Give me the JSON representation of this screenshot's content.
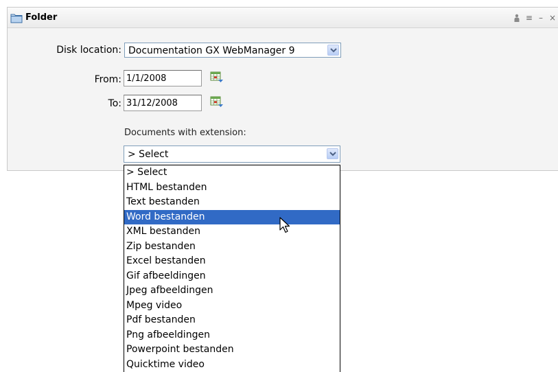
{
  "panel": {
    "title": "Folder",
    "icons": [
      "folder-icon",
      "person-icon",
      "menu-icon",
      "minimize-icon",
      "close-icon"
    ]
  },
  "disk": {
    "label": "Disk location:",
    "value": "Documentation GX WebManager 9"
  },
  "from": {
    "label": "From:",
    "value": "1/1/2008"
  },
  "to": {
    "label": "To:",
    "value": "31/12/2008"
  },
  "extension": {
    "label": "Documents with extension:",
    "value": "> Select",
    "options": [
      "> Select",
      "HTML bestanden",
      "Text bestanden",
      "Word bestanden",
      "XML bestanden",
      "Zip bestanden",
      "Excel bestanden",
      "Gif afbeeldingen",
      "Jpeg afbeeldingen",
      "Mpeg video",
      "Pdf bestanden",
      "Png afbeeldingen",
      "Powerpoint bestanden",
      "Quicktime video"
    ],
    "highlighted": "Word bestanden"
  },
  "colors": {
    "selection": "#316ac5",
    "panel_bg": "#f4f4f4",
    "border": "#7f9db9"
  }
}
